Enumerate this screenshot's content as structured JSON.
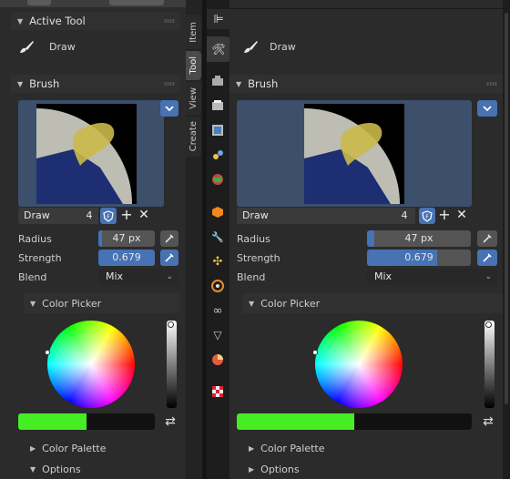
{
  "left": {
    "active_tool_header": "Active Tool",
    "tool_name": "Draw",
    "brush_header": "Brush",
    "brush_name": "Draw",
    "brush_users": "4",
    "radius_label": "Radius",
    "radius_value": "47 px",
    "strength_label": "Strength",
    "strength_value": "0.679",
    "strength_fraction": 0.679,
    "blend_label": "Blend",
    "blend_value": "Mix",
    "color_picker_header": "Color Picker",
    "current_color": "#44ee22",
    "color_palette_header": "Color Palette",
    "options_header": "Options"
  },
  "tabs": [
    {
      "label": "Item",
      "active": false
    },
    {
      "label": "Tool",
      "active": true
    },
    {
      "label": "View",
      "active": false
    },
    {
      "label": "Create",
      "active": false
    }
  ],
  "properties_sidebar": {
    "icons": [
      "tool-settings-icon",
      "render-icon",
      "output-icon",
      "view-layer-icon",
      "scene-icon",
      "world-icon",
      "object-icon",
      "modifier-icon",
      "particles-icon",
      "physics-icon",
      "constraints-icon",
      "object-data-icon",
      "material-icon",
      "texture-icon"
    ]
  },
  "right": {
    "tool_name": "Draw",
    "brush_header": "Brush",
    "brush_name": "Draw",
    "brush_users": "4",
    "radius_label": "Radius",
    "radius_value": "47 px",
    "strength_label": "Strength",
    "strength_value": "0.679",
    "strength_fraction": 0.679,
    "blend_label": "Blend",
    "blend_value": "Mix",
    "color_picker_header": "Color Picker",
    "current_color": "#44ee22",
    "color_palette_header": "Color Palette",
    "options_header": "Options"
  }
}
